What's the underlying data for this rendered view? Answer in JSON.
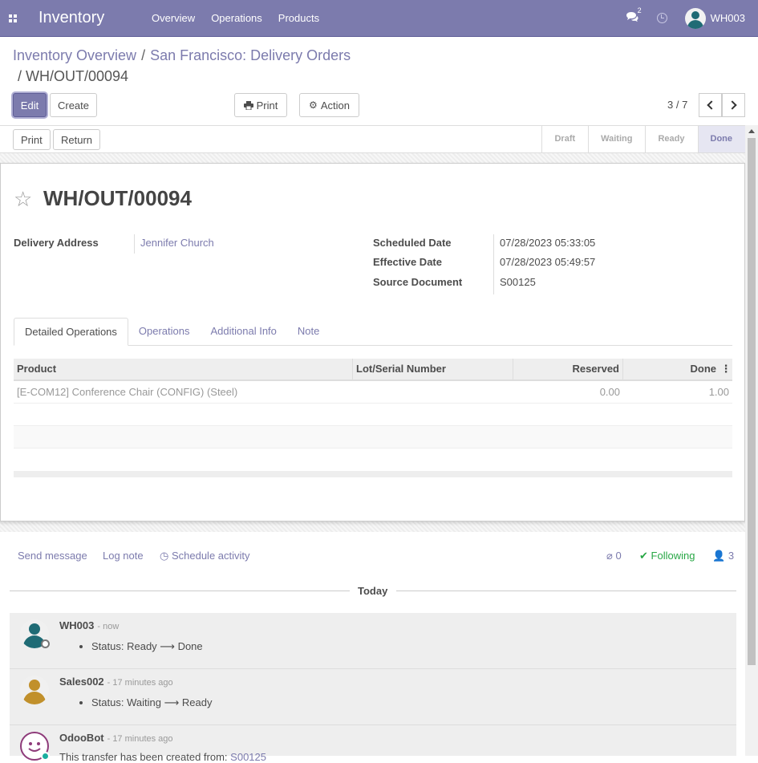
{
  "navbar": {
    "brand": "Inventory",
    "menu": [
      "Overview",
      "Operations",
      "Products"
    ],
    "chat_count": "2",
    "user": "WH003",
    "color": "#7c7bad"
  },
  "breadcrumb": {
    "items": [
      "Inventory Overview",
      "San Francisco: Delivery Orders"
    ],
    "sep": "/",
    "current": "WH/OUT/00094"
  },
  "actions": {
    "edit": "Edit",
    "create": "Create",
    "print": "Print",
    "action": "Action"
  },
  "pager": {
    "value": "3 / 7"
  },
  "statusbar": {
    "buttons": [
      "Print",
      "Return"
    ],
    "stages": [
      "Draft",
      "Waiting",
      "Ready",
      "Done"
    ],
    "current_stage": "Done"
  },
  "record": {
    "title": "WH/OUT/00094",
    "delivery_address_label": "Delivery Address",
    "delivery_address": "Jennifer Church",
    "scheduled_date_label": "Scheduled Date",
    "scheduled_date": "07/28/2023 05:33:05",
    "effective_date_label": "Effective Date",
    "effective_date": "07/28/2023 05:49:57",
    "source_document_label": "Source Document",
    "source_document": "S00125"
  },
  "tabs": [
    "Detailed Operations",
    "Operations",
    "Additional Info",
    "Note"
  ],
  "table": {
    "columns": [
      "Product",
      "Lot/Serial Number",
      "Reserved",
      "Done"
    ],
    "rows": [
      {
        "product": "[E-COM12] Conference Chair (CONFIG) (Steel)",
        "lot": "",
        "reserved": "0.00",
        "done": "1.00"
      }
    ]
  },
  "chatter": {
    "send_message": "Send message",
    "log_note": "Log note",
    "schedule_activity": "Schedule activity",
    "attachments": "0",
    "following": "Following",
    "followers": "3",
    "day_label": "Today",
    "messages": [
      {
        "author": "WH003",
        "when": "- now",
        "from": "Ready",
        "to": "Done",
        "label": "Status:"
      },
      {
        "author": "Sales002",
        "when": "- 17 minutes ago",
        "from": "Waiting",
        "to": "Ready",
        "label": "Status:"
      },
      {
        "author": "OdooBot",
        "when": "- 17 minutes ago",
        "text": "This transfer has been created from:",
        "link": "S00125"
      }
    ]
  }
}
